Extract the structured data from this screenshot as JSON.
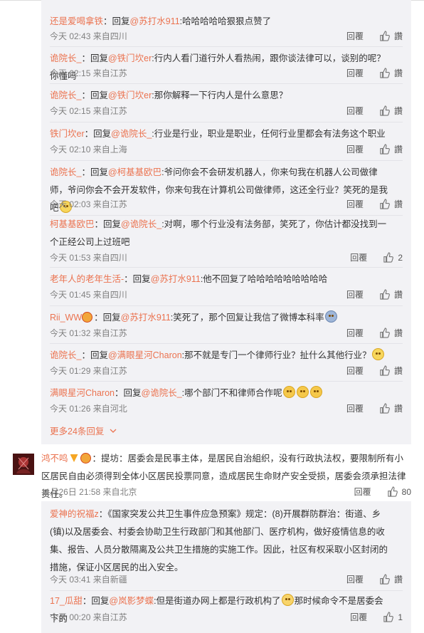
{
  "replies_panel": {
    "items": [
      {
        "user": "还是爱喝拿铁",
        "text_pre": "：回复",
        "at": "@苏打水911",
        "text": ":哈哈哈哈哈狠狠点赞了",
        "time": "今天 02:43 来自四川",
        "reply": "回覆",
        "like": "讚"
      },
      {
        "user": "诡院长_",
        "text_pre": "：回复",
        "at": "@铁门坎er",
        "text": ":行内人看门道行外人看热闹，跟你谈法律可以，谈别的呢？你懂吗",
        "time": "今天 02:15 来自江苏",
        "reply": "回覆",
        "like": "讚"
      },
      {
        "user": "诡院长_",
        "text_pre": "：回复",
        "at": "@铁门坎er",
        "text": ":那你解释一下行内人是什么意思？",
        "time": "今天 02:15 来自江苏",
        "reply": "回覆",
        "like": "讚"
      },
      {
        "user": "铁门坎er",
        "text_pre": "：回复",
        "at": "@诡院长_",
        "text": ":行业是行业，职业是职业，任何行业里都会有法务这个职业",
        "time": "今天 02:10 来自上海",
        "reply": "回覆",
        "like": "讚"
      },
      {
        "user": "诡院长_",
        "text_pre": "：回复",
        "at": "@柯基基欧巴",
        "text": ":爷问你会不会研发机器人，你来句我在机器人公司做律师，爷问你会不会开发软件，你来句我在计算机公司做律师，这还全行业？笑死的是我吧",
        "time": "今天 02:03 来自江苏",
        "reply": "回覆",
        "like": "讚"
      },
      {
        "user": "柯基基欧巴",
        "text_pre": "：回复",
        "at": "@诡院长_",
        "text": ":对啊，哪个行业没有法务部，笑死了，你估计都没找到一个正经公司上过班吧",
        "time": "今天 01:53 来自四川",
        "reply": "回覆",
        "like": "2"
      },
      {
        "user": "老年人的老年生活-",
        "text_pre": "：回复",
        "at": "@苏打水911",
        "text": ":他不回复了哈哈哈哈哈哈哈哈哈",
        "time": "今天 01:45 来自四川",
        "reply": "回覆",
        "like": "讚"
      },
      {
        "user": "Rii_WW",
        "text_pre": "：回复",
        "at": "@苏打水911",
        "text": ":笑死了，那个回复让我信了微博本科率",
        "time": "今天 01:32 来自江苏",
        "reply": "回覆",
        "like": "讚"
      },
      {
        "user": "诡院长_",
        "text_pre": "：回复",
        "at": "@满眼星河Charon",
        "text": ":那不就是专门一个律师行业？扯什么其他行业？",
        "time": "今天 01:29 来自江苏",
        "reply": "回覆",
        "like": "讚"
      },
      {
        "user": "满眼星河Charon",
        "text_pre": "：回复",
        "at": "@诡院长_",
        "text": ":哪个部门不和律师合作呢",
        "time": "今天 01:26 来自河北",
        "reply": "回覆",
        "like": "讚"
      }
    ],
    "more_label": "更多24条回复"
  },
  "main_comment": {
    "user": "鸿不鸣",
    "text": "：提坊：居委会是民事主体，是居民自治組织，没有行政执法权，要限制所有小区居民自由必须得到全体小区居民投票同意，造成居民生命财产安全受损，居委会须承担法律责任。",
    "time": "11月26日 21:58 来自北京",
    "reply": "回覆",
    "like": "80"
  },
  "replies_panel2": {
    "items": [
      {
        "user": "爱神的祝福z",
        "text": "：《国家突发公共卫生事件应急预案》规定：(8)开展群防群治：街道、乡(镇)以及居委会、村委会协助卫生行政部门和其他部门、医疗机构，做好疫情信息的收集、报告、人员分散隔离及公共卫生措施的实施工作。因此，社区有权采取小区封闭的措施，保证小区居民的出入安全。",
        "time": "今天 03:41 来自新疆",
        "reply": "回覆",
        "like": "讚"
      },
      {
        "user": "17_瓜甜",
        "text_pre": "：回复",
        "at": "@岚影梦蝶",
        "text": ":但是街道办网上都是行政机构了",
        "text2": "那时候命令不是居委会下的",
        "time": "今天 00:20 来自江苏",
        "reply": "回覆",
        "like": "1"
      }
    ]
  }
}
